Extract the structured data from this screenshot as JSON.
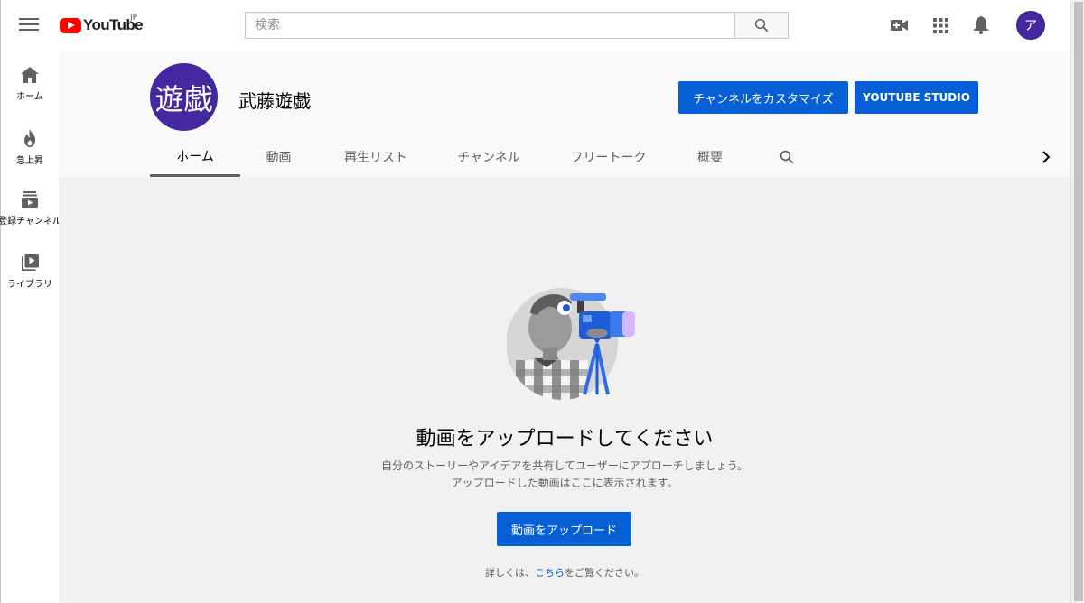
{
  "masthead": {
    "logo_text": "YouTube",
    "region": "JP",
    "search_placeholder": "検索",
    "icons": [
      "menu-icon",
      "search-icon",
      "create-video-icon",
      "apps-icon",
      "notifications-icon"
    ],
    "avatar_letter": "ア"
  },
  "guide": {
    "items": [
      {
        "label": "ホーム",
        "icon": "home-icon"
      },
      {
        "label": "急上昇",
        "icon": "trending-icon"
      },
      {
        "label": "登録チャンネル",
        "icon": "subscriptions-icon"
      },
      {
        "label": "ライブラリ",
        "icon": "library-icon"
      }
    ]
  },
  "channel": {
    "avatar_text": "遊戯",
    "name": "武藤遊戯",
    "customize_label": "チャンネルをカスタマイズ",
    "studio_label": "YOUTUBE STUDIO",
    "tabs": [
      "ホーム",
      "動画",
      "再生リスト",
      "チャンネル",
      "フリートーク",
      "概要"
    ],
    "active_tab": "ホーム"
  },
  "empty_state": {
    "title": "動画をアップロードしてください",
    "desc_line1": "自分のストーリーやアイデアを共有してユーザーにアプローチしましょう。",
    "desc_line2": "アップロードした動画はここに表示されます。",
    "upload_label": "動画をアップロード",
    "learn_prefix": "詳しくは、",
    "learn_link": "こちら",
    "learn_suffix": "をご覧ください。"
  },
  "colors": {
    "accent": "#065fd4",
    "logo_red": "#ff0000",
    "avatar": "#4527a0"
  }
}
